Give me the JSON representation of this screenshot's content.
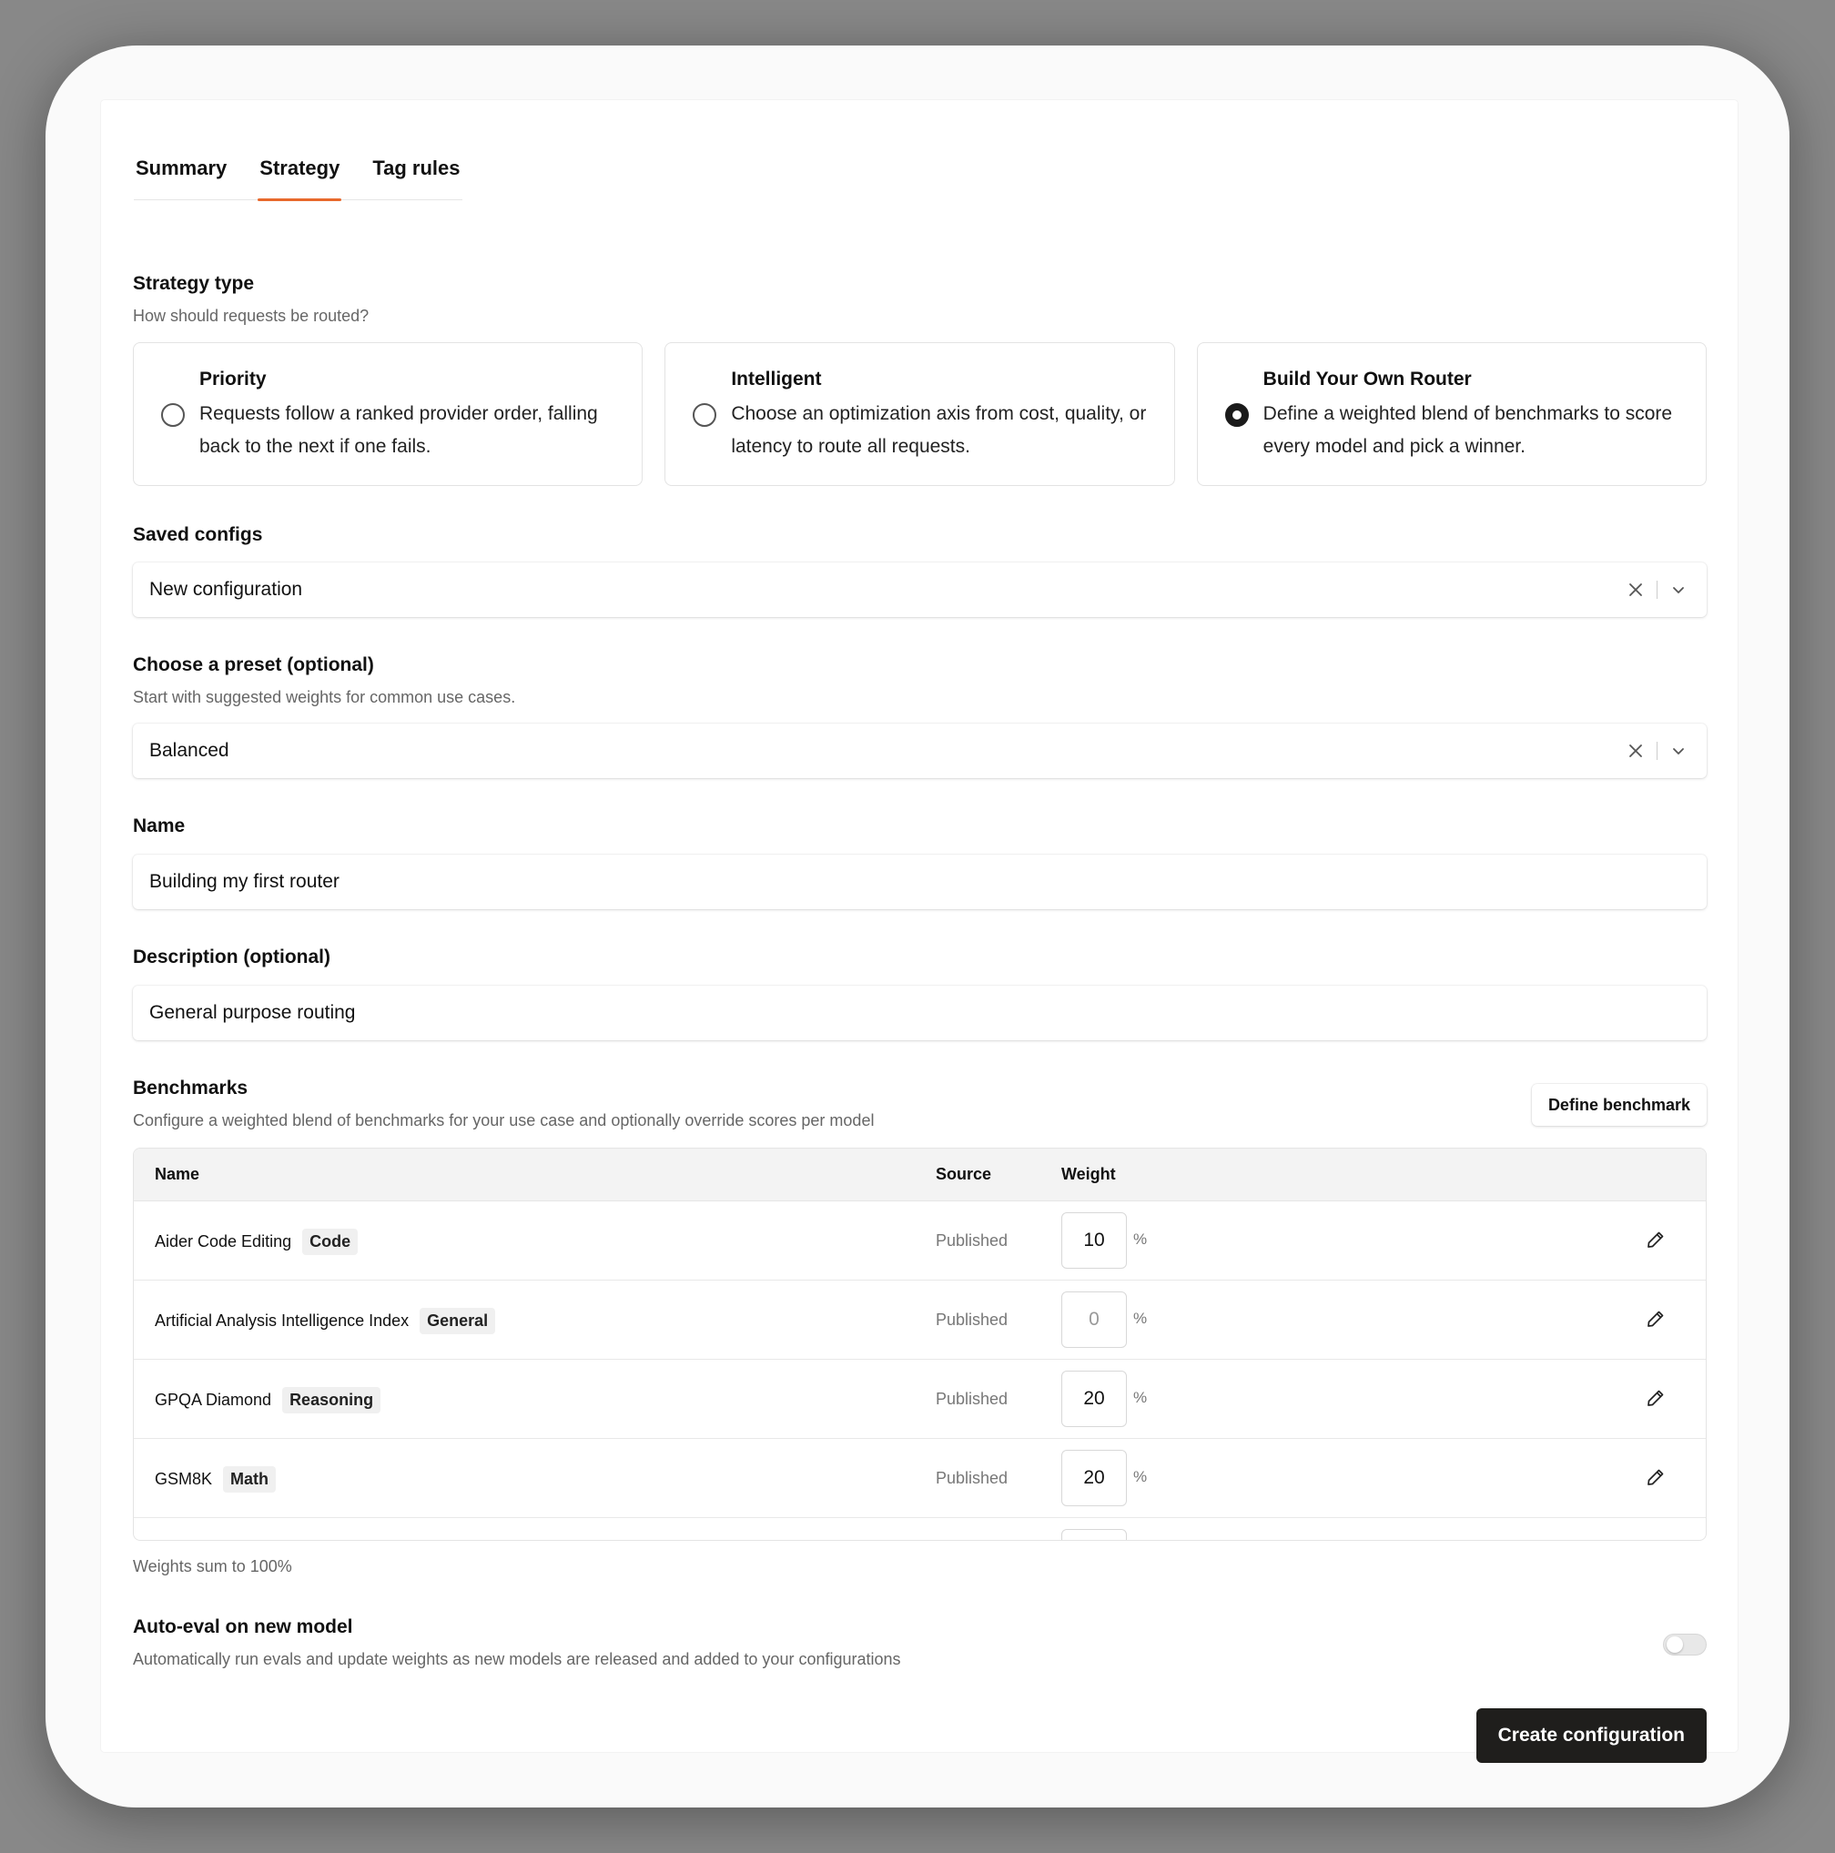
{
  "tabs": [
    {
      "label": "Summary"
    },
    {
      "label": "Strategy"
    },
    {
      "label": "Tag rules"
    }
  ],
  "strategy": {
    "title": "Strategy type",
    "subtitle": "How should requests be routed?",
    "options": [
      {
        "title": "Priority",
        "description": "Requests follow a ranked provider order, falling back to the next if one fails.",
        "selected": false
      },
      {
        "title": "Intelligent",
        "description": "Choose an optimization axis from cost, quality, or latency to route all requests.",
        "selected": false
      },
      {
        "title": "Build Your Own Router",
        "description": "Define a weighted blend of benchmarks to score every model and pick a winner.",
        "selected": true
      }
    ]
  },
  "saved_configs": {
    "label": "Saved configs",
    "value": "New configuration"
  },
  "preset": {
    "label": "Choose a preset (optional)",
    "subtitle": "Start with suggested weights for common use cases.",
    "value": "Balanced"
  },
  "name_field": {
    "label": "Name",
    "value": "Building my first router"
  },
  "description_field": {
    "label": "Description (optional)",
    "value": "General purpose routing"
  },
  "benchmarks": {
    "title": "Benchmarks",
    "subtitle": "Configure a weighted blend of benchmarks for your use case and optionally override scores per model",
    "define_button": "Define benchmark",
    "columns": {
      "name": "Name",
      "source": "Source",
      "weight": "Weight"
    },
    "rows": [
      {
        "name": "Aider Code Editing",
        "tag": "Code",
        "source": "Published",
        "weight": "10",
        "unit": "%"
      },
      {
        "name": "Artificial Analysis Intelligence Index",
        "tag": "General",
        "source": "Published",
        "weight": "0",
        "unit": "%"
      },
      {
        "name": "GPQA Diamond",
        "tag": "Reasoning",
        "source": "Published",
        "weight": "20",
        "unit": "%"
      },
      {
        "name": "GSM8K",
        "tag": "Math",
        "source": "Published",
        "weight": "20",
        "unit": "%"
      }
    ],
    "footnote": "Weights sum to 100%"
  },
  "auto_eval": {
    "title": "Auto-eval on new model",
    "subtitle": "Automatically run evals and update weights as new models are released and added to your configurations",
    "enabled": false
  },
  "create_button": "Create configuration",
  "colors": {
    "accent": "#e8692c",
    "primary_button": "#1f1e1c"
  }
}
